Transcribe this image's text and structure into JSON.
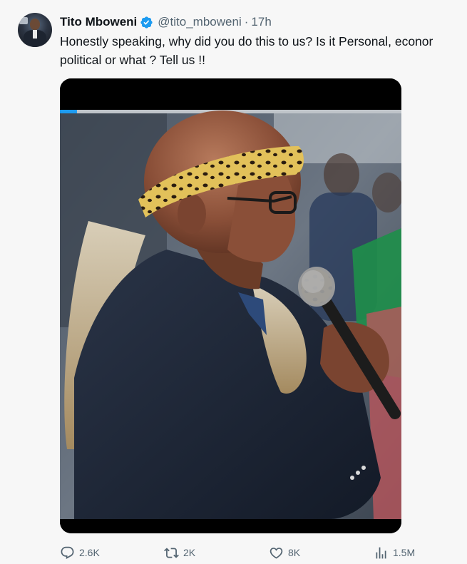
{
  "tweet": {
    "author_name": "Tito Mboweni",
    "handle": "@tito_mboweni",
    "separator": "·",
    "time": "17h",
    "text_line1": "Honestly speaking, why did you do this to us? Is it Personal, econor",
    "text_line2": "political or what ? Tell us !!"
  },
  "media": {
    "type": "video",
    "progress_fraction": 0.05
  },
  "actions": {
    "replies": "2.6K",
    "retweets": "2K",
    "likes": "8K",
    "views": "1.5M"
  },
  "colors": {
    "verified": "#1d9bf0",
    "secondary_text": "#536471",
    "progress": "#1d9bf0"
  },
  "icons": [
    "verified-badge-icon",
    "reply-icon",
    "retweet-icon",
    "like-icon",
    "views-icon"
  ]
}
